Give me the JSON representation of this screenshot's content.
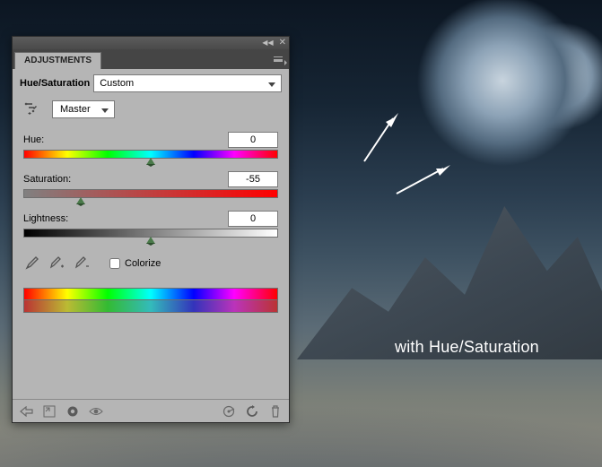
{
  "panel": {
    "tab_label": "ADJUSTMENTS",
    "adjustment_name": "Hue/Saturation",
    "preset": "Custom",
    "edit_range": "Master",
    "hue": {
      "label": "Hue:",
      "value": "0",
      "thumb_pct": 50
    },
    "saturation": {
      "label": "Saturation:",
      "value": "-55",
      "thumb_pct": 22.5
    },
    "lightness": {
      "label": "Lightness:",
      "value": "0",
      "thumb_pct": 50
    },
    "colorize_label": "Colorize",
    "colorize_checked": false
  },
  "caption": "with Hue/Saturation"
}
